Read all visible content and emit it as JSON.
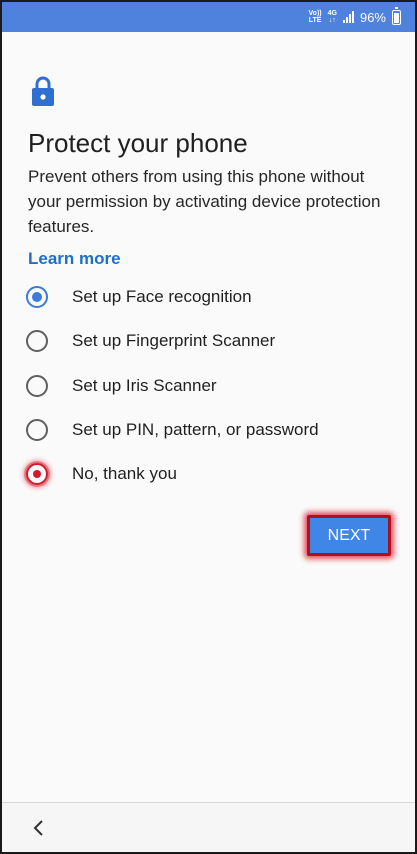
{
  "status_bar": {
    "volte_label_top": "Vo))",
    "volte_label_bottom": "LTE",
    "network_label_top": "4G",
    "network_label_bottom": "↓↑",
    "battery_percent": "96%",
    "battery_level": 0.96,
    "background_color": "#4e82dc"
  },
  "header": {
    "icon": "lock-icon",
    "title": "Protect your phone",
    "description": "Prevent others from using this phone without your permission by activating device protection features.",
    "learn_more": "Learn more"
  },
  "options": [
    {
      "label": "Set up Face recognition",
      "selected": true
    },
    {
      "label": "Set up Fingerprint Scanner",
      "selected": false
    },
    {
      "label": "Set up Iris Scanner",
      "selected": false
    },
    {
      "label": "Set up PIN, pattern, or password",
      "selected": false
    },
    {
      "label": "No, thank you",
      "selected": false,
      "highlighted": true
    }
  ],
  "actions": {
    "next_label": "NEXT"
  },
  "nav": {
    "back_icon": "back-chevron-icon"
  },
  "colors": {
    "accent": "#3a7bdc",
    "link": "#1f6fc6",
    "highlight": "#cf1b2c"
  }
}
